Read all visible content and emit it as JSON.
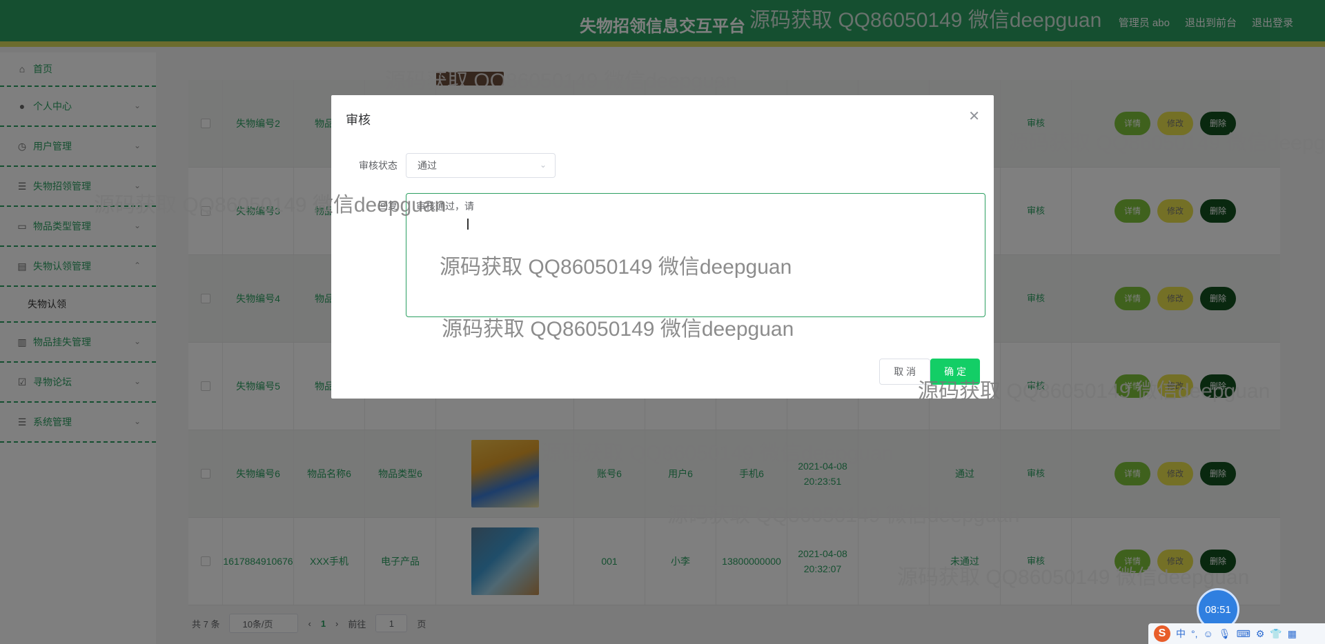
{
  "header": {
    "title": "失物招领信息交互平台",
    "admin": "管理员 abo",
    "front": "退出到前台",
    "logout": "退出登录"
  },
  "sidebar": {
    "items": [
      {
        "label": "首页",
        "icon": "home-icon"
      },
      {
        "label": "个人中心",
        "icon": "user-icon"
      },
      {
        "label": "用户管理",
        "icon": "clock-icon"
      },
      {
        "label": "失物招领管理",
        "icon": "list-icon"
      },
      {
        "label": "物品类型管理",
        "icon": "chat-icon"
      },
      {
        "label": "失物认领管理",
        "icon": "clipboard-icon",
        "sub": "失物认领"
      },
      {
        "label": "物品挂失管理",
        "icon": "chart-icon"
      },
      {
        "label": "寻物论坛",
        "icon": "check-icon"
      },
      {
        "label": "系统管理",
        "icon": "list-icon"
      }
    ]
  },
  "table": {
    "rows": [
      {
        "code": "失物编号2",
        "name": "物品名",
        "type": "",
        "account": "",
        "user": "",
        "phone": "",
        "time": "",
        "status": "",
        "audit": "审核"
      },
      {
        "code": "失物编号3",
        "name": "物品名",
        "type": "",
        "account": "",
        "user": "",
        "phone": "",
        "time": "",
        "status": "",
        "audit": "审核"
      },
      {
        "code": "失物编号4",
        "name": "物品名",
        "type": "",
        "account": "",
        "user": "",
        "phone": "",
        "time": "",
        "status": "",
        "audit": "审核"
      },
      {
        "code": "失物编号5",
        "name": "物品名",
        "type": "",
        "account": "",
        "user": "",
        "phone": "",
        "time": "",
        "status": "",
        "audit": "审核"
      },
      {
        "code": "失物编号6",
        "name": "物品名称6",
        "type": "物品类型6",
        "account": "账号6",
        "user": "用户6",
        "phone": "手机6",
        "time": "2021-04-08 20:23:51",
        "status": "通过",
        "audit": "审核"
      },
      {
        "code": "1617884910676",
        "name": "XXX手机",
        "type": "电子产品",
        "account": "001",
        "user": "小李",
        "phone": "13800000000",
        "time": "2021-04-08 20:32:07",
        "status": "未通过",
        "audit": "审核"
      }
    ],
    "btn_detail": "详情",
    "btn_edit": "修改",
    "btn_delete": "删除"
  },
  "pager": {
    "total": "共 7 条",
    "per_page": "10条/页",
    "current": "1",
    "goto": "前往",
    "goto_value": "1",
    "page_unit": "页"
  },
  "dialog": {
    "title": "审核",
    "status_label": "审核状态",
    "status_value": "通过",
    "reply_label": "回复",
    "reply_value": "审核通过，请"
  },
  "dialog_buttons": {
    "cancel": "取 消",
    "ok": "确 定"
  },
  "watermark": "源码获取 QQ86050149 微信deepguan",
  "clock": "08:51",
  "ime": {
    "s": "S",
    "lang": "中",
    "punct": "°,"
  }
}
